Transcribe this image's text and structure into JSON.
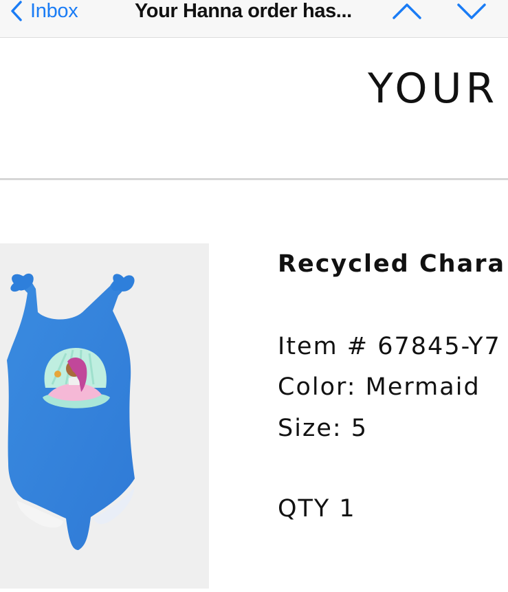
{
  "nav": {
    "back_label": "Inbox",
    "title": "Your Hanna order has...",
    "colors": {
      "accent": "#1a7cf5"
    }
  },
  "email": {
    "brand_heading": "YOUR",
    "product": {
      "name": "Recycled Chara",
      "item": "Item # 67845-Y7",
      "color": "Color: Mermaid",
      "size": "Size: 5",
      "qty": "QTY 1"
    }
  }
}
